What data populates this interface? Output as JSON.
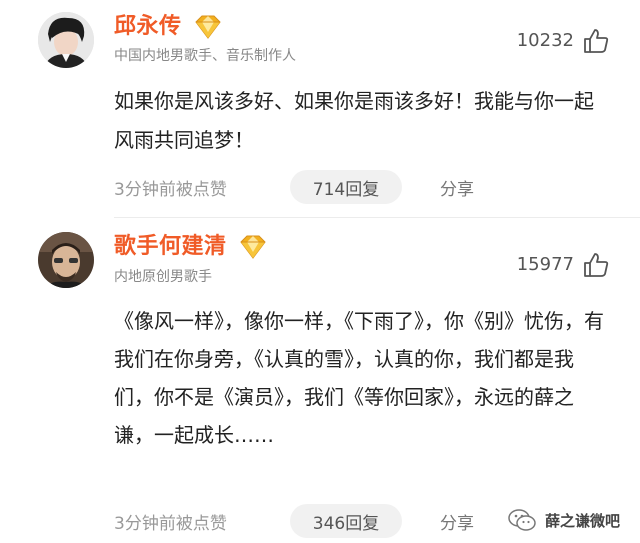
{
  "comments": [
    {
      "username": "邱永传",
      "subtitle": "中国内地男歌手、音乐制作人",
      "likes": "10232",
      "body": "如果你是风该多好、如果你是雨该多好！我能与你一起风雨共同追梦！",
      "time": "3分钟前被点赞",
      "replies": "714回复",
      "share": "分享"
    },
    {
      "username": "歌手何建清",
      "subtitle": "内地原创男歌手",
      "likes": "15977",
      "body": "《像风一样》，像你一样，《下雨了》，你《别》忧伤，有我们在你身旁，《认真的雪》，认真的你，我们都是我们，你不是《演员》，我们《等你回家》，永远的薛之谦，一起成长……",
      "time": "3分钟前被点赞",
      "replies": "346回复",
      "share": "分享"
    }
  ],
  "watermark": {
    "text": "薛之谦微吧"
  },
  "colors": {
    "username": "#f05b27",
    "badge": "#f2b01e",
    "muted": "#999999",
    "pill_bg": "#f1f1f1"
  },
  "icons": {
    "badge": "diamond-badge-icon",
    "like": "thumbs-up-icon",
    "watermark": "wechat-icon"
  }
}
